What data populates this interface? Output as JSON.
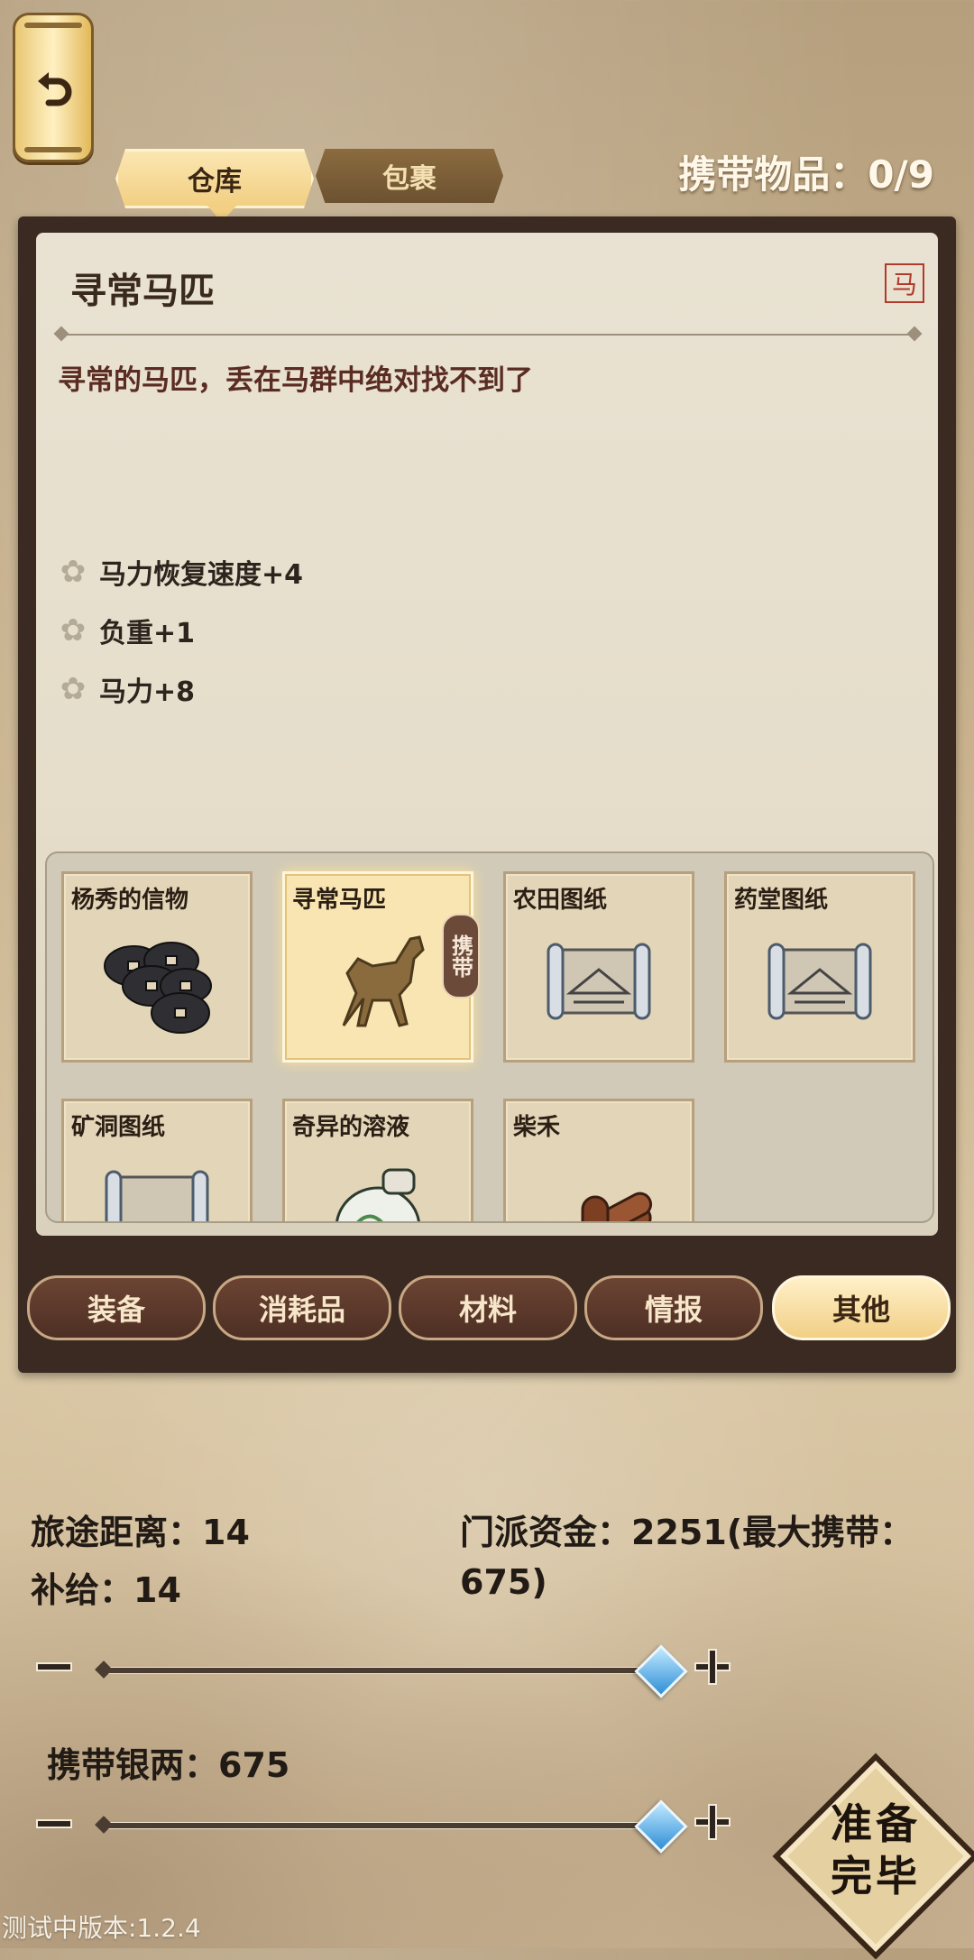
{
  "tabs": [
    {
      "label": "仓库",
      "active": true
    },
    {
      "label": "包裹",
      "active": false
    }
  ],
  "carry_count": "携带物品：0/9",
  "detail": {
    "title": "寻常马匹",
    "seal": "马",
    "description": "寻常的马匹，丢在马群中绝对找不到了",
    "stats": [
      "马力恢复速度+4",
      "负重+1",
      "马力+8"
    ]
  },
  "items": [
    {
      "name": "杨秀的信物",
      "icon": "coins-icon",
      "selected": false
    },
    {
      "name": "寻常马匹",
      "icon": "horse-icon",
      "selected": true,
      "tag": "携带"
    },
    {
      "name": "农田图纸",
      "icon": "scroll-icon",
      "selected": false
    },
    {
      "name": "药堂图纸",
      "icon": "scroll-icon",
      "selected": false
    },
    {
      "name": "矿洞图纸",
      "icon": "scroll-icon",
      "selected": false
    },
    {
      "name": "奇异的溶液",
      "icon": "potion-icon",
      "selected": false
    },
    {
      "name": "柴禾",
      "icon": "firewood-icon",
      "selected": false
    }
  ],
  "categories": [
    {
      "label": "装备",
      "active": false
    },
    {
      "label": "消耗品",
      "active": false
    },
    {
      "label": "材料",
      "active": false
    },
    {
      "label": "情报",
      "active": false
    },
    {
      "label": "其他",
      "active": true
    }
  ],
  "travel": {
    "distance": "旅途距离：14",
    "supply": "补给：14",
    "funds_line1": "门派资金：2251(最大携带：",
    "funds_line2": "675)",
    "supply_slider_fraction": 1.0
  },
  "silver": {
    "label": "携带银两：675",
    "slider_fraction": 1.0
  },
  "ready_button": {
    "line1": "准备",
    "line2": "完毕"
  },
  "version": "测试中版本:1.2.4"
}
